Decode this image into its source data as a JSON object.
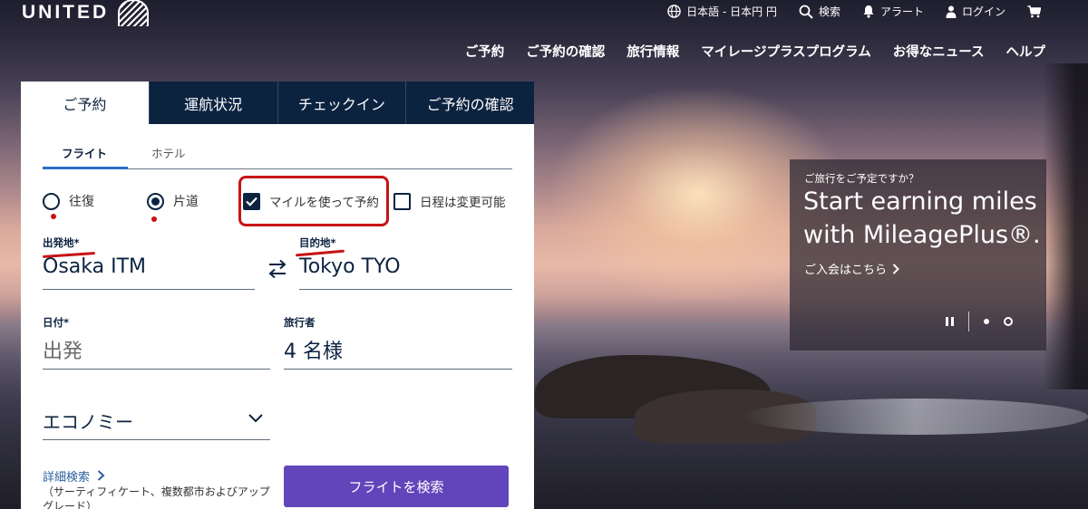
{
  "header": {
    "logo_text": "UNITED",
    "utility": {
      "language": "日本語 - 日本円 円",
      "search": "検索",
      "alerts": "アラート",
      "login": "ログイン"
    },
    "nav": [
      "ご予約",
      "ご予約の確認",
      "旅行情報",
      "マイレージプラスプログラム",
      "お得なニュース",
      "ヘルプ"
    ]
  },
  "booking": {
    "tabs": [
      "ご予約",
      "運航状況",
      "チェックイン",
      "ご予約の確認"
    ],
    "active_tab": 0,
    "subtabs": [
      "フライト",
      "ホテル"
    ],
    "trip_type": {
      "roundtrip": "往復",
      "oneway": "片道",
      "selected": "oneway"
    },
    "use_miles": {
      "label": "マイルを使って予約",
      "checked": true
    },
    "flexible_dates": {
      "label": "日程は変更可能",
      "checked": false
    },
    "origin": {
      "label": "出発地*",
      "value": "Osaka ITM"
    },
    "destination": {
      "label": "目的地*",
      "value": "Tokyo TYO"
    },
    "date": {
      "label": "日付*",
      "placeholder": "出発"
    },
    "travelers": {
      "label": "旅行者",
      "value": "4 名様"
    },
    "cabin": {
      "value": "エコノミー"
    },
    "advanced_search": {
      "label": "詳細検索",
      "note": "（サーティフィケート、複数都市およびアップグレード）"
    },
    "search_button": "フライトを検索"
  },
  "promo": {
    "eyebrow": "ご旅行をご予定ですか？",
    "headline": "Start earning miles with MileagePlus®.",
    "cta": "ご入会はこちら"
  },
  "colors": {
    "navy": "#0c2340",
    "purple_button": "#6244bb",
    "annotation_red": "#c81414",
    "link_blue": "#2a5f9e"
  }
}
